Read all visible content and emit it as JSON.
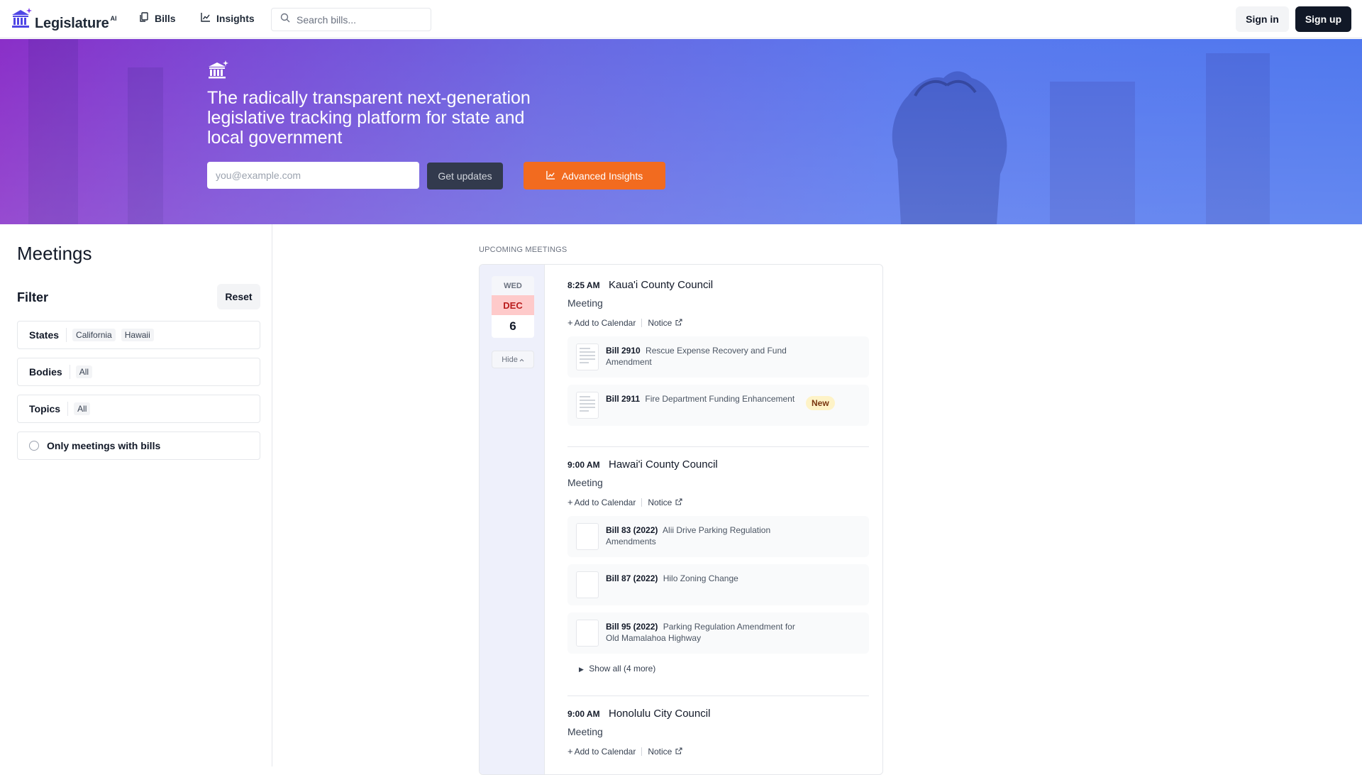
{
  "nav": {
    "logo_text": "Legislature",
    "logo_sup": "AI",
    "links": [
      {
        "label": "Bills",
        "icon": "copy-icon"
      },
      {
        "label": "Insights",
        "icon": "chart-icon"
      }
    ],
    "search_placeholder": "Search bills...",
    "signin_label": "Sign in",
    "signup_label": "Sign up"
  },
  "hero": {
    "title": "The radically transparent next-generation legislative tracking platform for state and local government",
    "email_placeholder": "you@example.com",
    "updates_label": "Get updates",
    "insights_label": "Advanced Insights"
  },
  "sidebar": {
    "title": "Meetings",
    "filter_title": "Filter",
    "reset_label": "Reset",
    "filters": [
      {
        "label": "States",
        "chips": [
          "California",
          "Hawaii"
        ]
      },
      {
        "label": "Bodies",
        "chips": [
          "All"
        ]
      },
      {
        "label": "Topics",
        "chips": [
          "All"
        ]
      }
    ],
    "only_with_bills_label": "Only meetings with bills"
  },
  "main": {
    "section_label": "UPCOMING MEETINGS",
    "date": {
      "day": "WED",
      "month": "DEC",
      "num": "6"
    },
    "hide_label": "Hide",
    "add_to_calendar": "Add to Calendar",
    "notice": "Notice",
    "meetings": [
      {
        "time": "8:25 AM",
        "body": "Kaua'i County Council",
        "type": "Meeting",
        "bills": [
          {
            "num": "Bill 2910",
            "title": "Rescue Expense Recovery and Fund Amendment",
            "badge": ""
          },
          {
            "num": "Bill 2911",
            "title": "Fire Department Funding Enhancement",
            "badge": "New"
          }
        ]
      },
      {
        "time": "9:00 AM",
        "body": "Hawai'i County Council",
        "type": "Meeting",
        "bills": [
          {
            "num": "Bill 83 (2022)",
            "title": "Alii Drive Parking Regulation Amendments",
            "badge": ""
          },
          {
            "num": "Bill 87 (2022)",
            "title": "Hilo Zoning Change",
            "badge": ""
          },
          {
            "num": "Bill 95 (2022)",
            "title": "Parking Regulation Amendment for Old Mamalahoa Highway",
            "badge": ""
          }
        ],
        "show_all": "Show all (4 more)"
      },
      {
        "time": "9:00 AM",
        "body": "Honolulu City Council",
        "type": "Meeting",
        "bills": []
      }
    ]
  },
  "colors": {
    "accent_orange": "#f26b1f",
    "hero_purple": "#8a2fc8",
    "hero_blue": "#4f78ee",
    "dark": "#111827"
  }
}
